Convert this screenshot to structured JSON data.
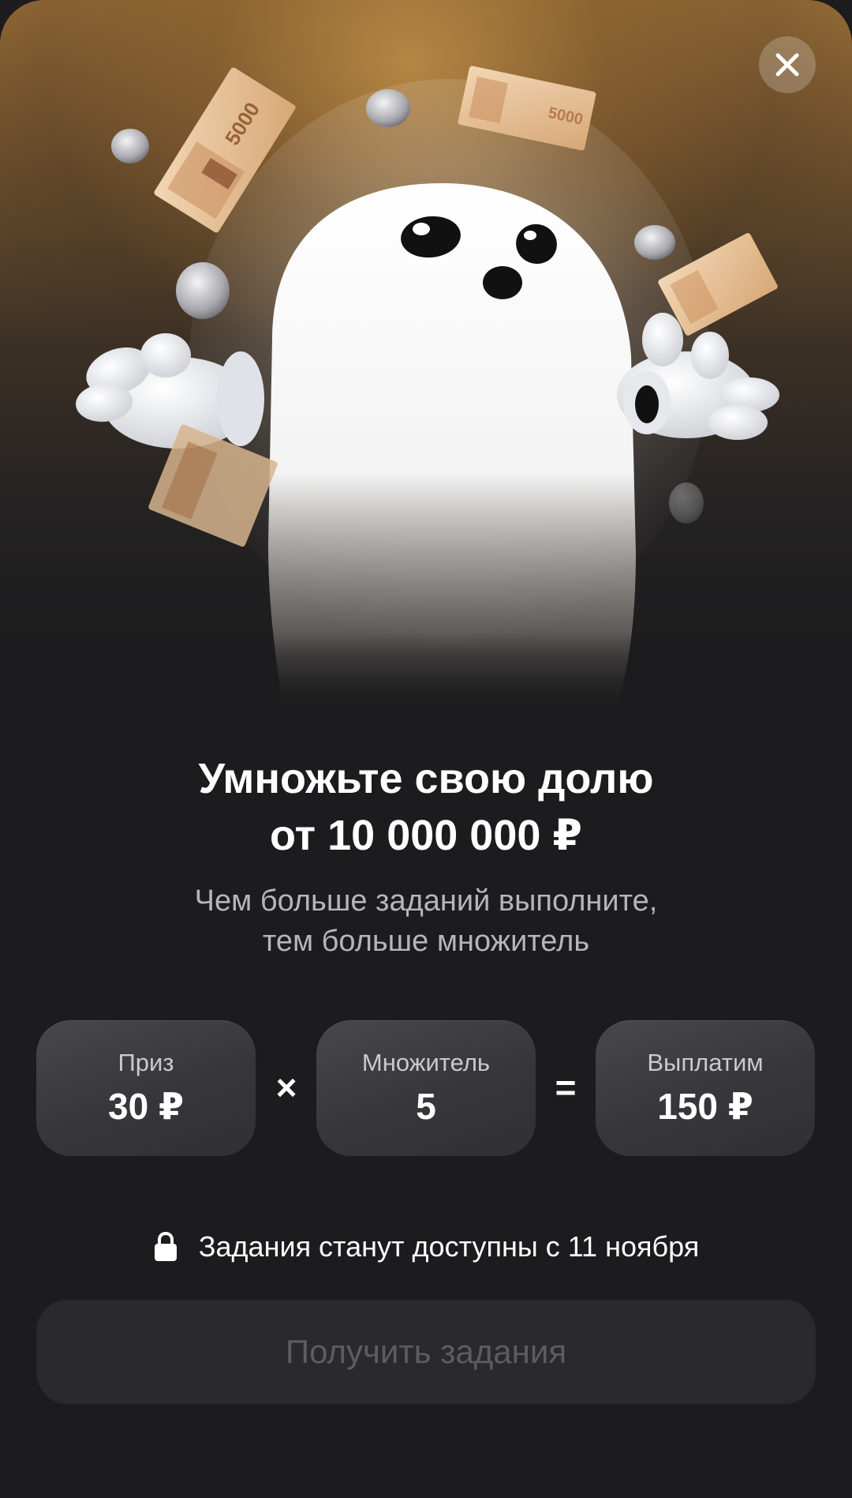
{
  "hero": {
    "illustration": "ghost-with-money-illustration",
    "banknote_denomination": "5000"
  },
  "close_icon": "close-icon",
  "headline": {
    "line1": "Умножьте свою долю",
    "line2": "от 10 000 000 ₽"
  },
  "subline": {
    "line1": "Чем больше заданий выполните,",
    "line2": "тем больше множитель"
  },
  "formula": {
    "prize_label": "Приз",
    "prize_value": "30 ₽",
    "times_sign": "×",
    "multiplier_label": "Множитель",
    "multiplier_value": "5",
    "equals_sign": "=",
    "payout_label": "Выплатим",
    "payout_value": "150 ₽"
  },
  "notice": {
    "icon": "lock-icon",
    "text": "Задания станут доступны с 11 ноября"
  },
  "cta": {
    "label": "Получить задания",
    "state": "disabled"
  },
  "colors": {
    "background": "#1c1c1e",
    "hero_gold": "#9a6e37",
    "card": "#3a3a3e",
    "button_disabled": "#2a2a2d",
    "button_text_disabled": "#5c5c61"
  }
}
